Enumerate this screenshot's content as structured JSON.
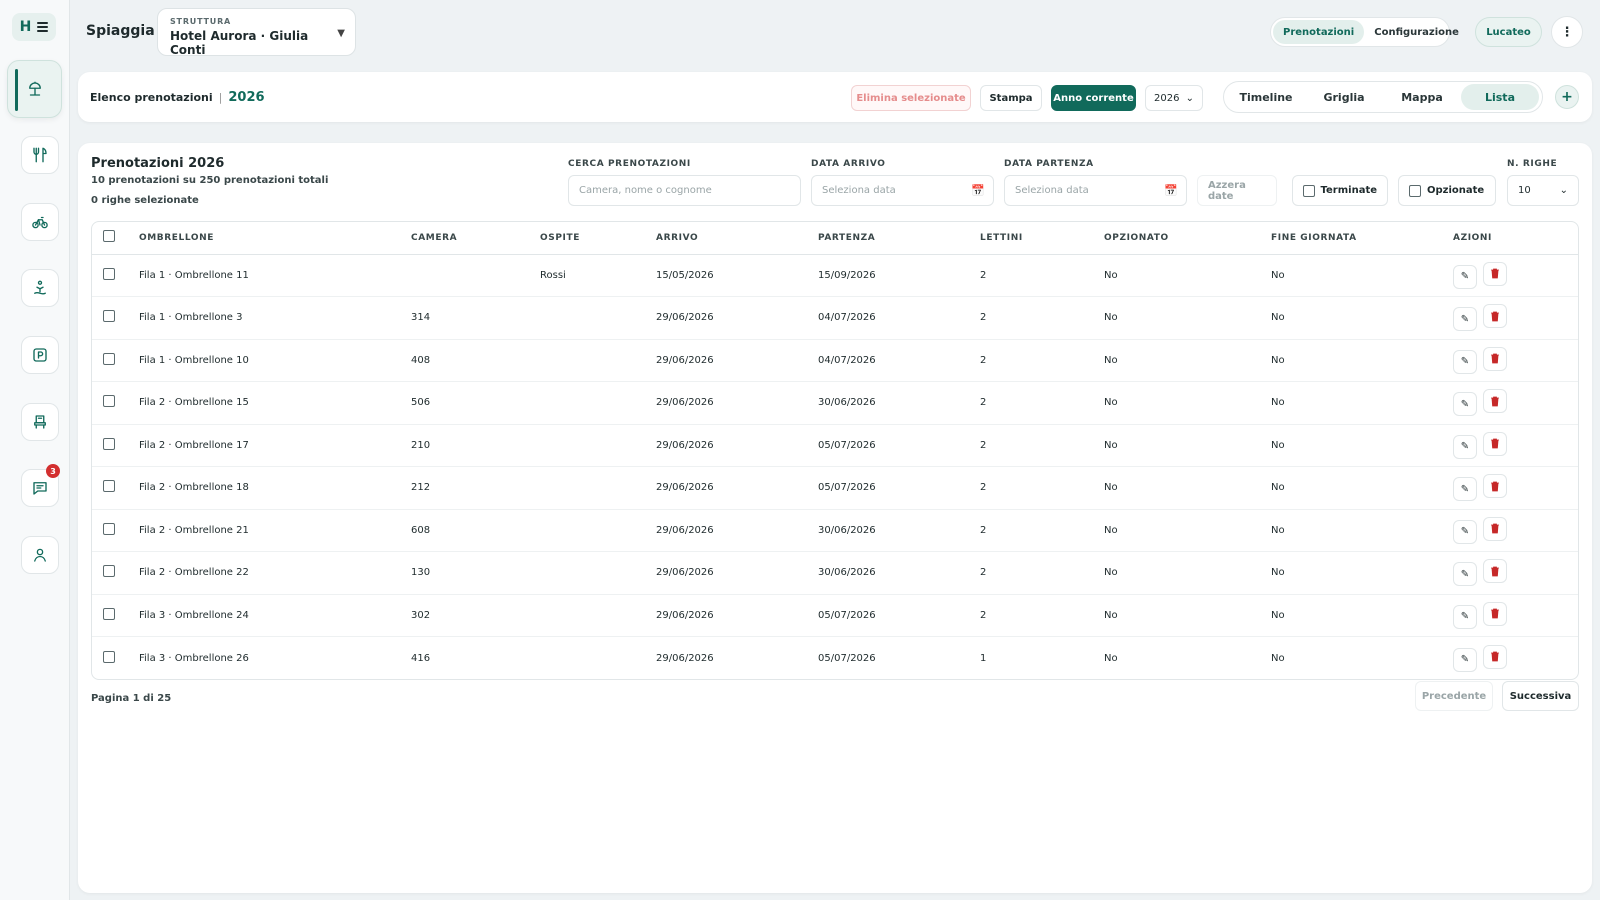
{
  "sidebar": {
    "logo_letter": "H",
    "items": [
      {
        "name": "beach-umbrella-icon"
      },
      {
        "name": "restaurant-icon"
      },
      {
        "name": "bike-icon"
      },
      {
        "name": "spa-icon"
      },
      {
        "name": "parking-icon"
      },
      {
        "name": "seat-icon"
      },
      {
        "name": "chat-icon",
        "badge": "3"
      },
      {
        "name": "user-icon"
      }
    ]
  },
  "header": {
    "title": "Spiaggia",
    "structure_label": "STRUTTURA",
    "structure_value": "Hotel Aurora · Giulia Conti",
    "tabs": [
      "Prenotazioni",
      "Configurazione"
    ],
    "active_tab": "Prenotazioni",
    "user_label": "Lucateo",
    "more_label": "⋮"
  },
  "toolbar": {
    "breadcrumb": "Elenco prenotazioni",
    "separator": "|",
    "year": "2026",
    "delete_selected": "Elimina selezionate",
    "print": "Stampa",
    "current_year": "Anno corrente",
    "year_select": "2026",
    "views": [
      "Timeline",
      "Griglia",
      "Mappa",
      "Lista"
    ],
    "active_view": "Lista",
    "add": "+"
  },
  "main": {
    "title": "Prenotazioni 2026",
    "subtitle": "10 prenotazioni su 250 prenotazioni totali",
    "selected": "0 righe selezionate",
    "filters": {
      "search_label": "CERCA PRENOTAZIONI",
      "search_placeholder": "Camera, nome o cognome",
      "arrival_label": "DATA ARRIVO",
      "arrival_placeholder": "Seleziona data",
      "departure_label": "DATA PARTENZA",
      "departure_placeholder": "Seleziona data",
      "reset_dates": "Azzera date",
      "finished": "Terminate",
      "optioned": "Opzionate",
      "rows_label": "N. RIGHE",
      "rows_value": "10"
    },
    "columns": [
      "OMBRELLONE",
      "CAMERA",
      "OSPITE",
      "ARRIVO",
      "PARTENZA",
      "LETTINI",
      "OPZIONATO",
      "FINE GIORNATA",
      "AZIONI"
    ],
    "rows": [
      {
        "umbrella": "Fila 1 · Ombrellone 11",
        "room": "",
        "guest": "Rossi",
        "arrival": "15/05/2026",
        "departure": "15/09/2026",
        "loungers": "2",
        "optioned": "No",
        "end_of_day": "No"
      },
      {
        "umbrella": "Fila 1 · Ombrellone 3",
        "room": "314",
        "guest": "",
        "arrival": "29/06/2026",
        "departure": "04/07/2026",
        "loungers": "2",
        "optioned": "No",
        "end_of_day": "No"
      },
      {
        "umbrella": "Fila 1 · Ombrellone 10",
        "room": "408",
        "guest": "",
        "arrival": "29/06/2026",
        "departure": "04/07/2026",
        "loungers": "2",
        "optioned": "No",
        "end_of_day": "No"
      },
      {
        "umbrella": "Fila 2 · Ombrellone 15",
        "room": "506",
        "guest": "",
        "arrival": "29/06/2026",
        "departure": "30/06/2026",
        "loungers": "2",
        "optioned": "No",
        "end_of_day": "No"
      },
      {
        "umbrella": "Fila 2 · Ombrellone 17",
        "room": "210",
        "guest": "",
        "arrival": "29/06/2026",
        "departure": "05/07/2026",
        "loungers": "2",
        "optioned": "No",
        "end_of_day": "No"
      },
      {
        "umbrella": "Fila 2 · Ombrellone 18",
        "room": "212",
        "guest": "",
        "arrival": "29/06/2026",
        "departure": "05/07/2026",
        "loungers": "2",
        "optioned": "No",
        "end_of_day": "No"
      },
      {
        "umbrella": "Fila 2 · Ombrellone 21",
        "room": "608",
        "guest": "",
        "arrival": "29/06/2026",
        "departure": "30/06/2026",
        "loungers": "2",
        "optioned": "No",
        "end_of_day": "No"
      },
      {
        "umbrella": "Fila 2 · Ombrellone 22",
        "room": "130",
        "guest": "",
        "arrival": "29/06/2026",
        "departure": "30/06/2026",
        "loungers": "2",
        "optioned": "No",
        "end_of_day": "No"
      },
      {
        "umbrella": "Fila 3 · Ombrellone 24",
        "room": "302",
        "guest": "",
        "arrival": "29/06/2026",
        "departure": "05/07/2026",
        "loungers": "2",
        "optioned": "No",
        "end_of_day": "No"
      },
      {
        "umbrella": "Fila 3 · Ombrellone 26",
        "room": "416",
        "guest": "",
        "arrival": "29/06/2026",
        "departure": "05/07/2026",
        "loungers": "1",
        "optioned": "No",
        "end_of_day": "No"
      }
    ],
    "pagination": {
      "info": "Pagina 1 di 25",
      "previous": "Precedente",
      "next": "Successiva"
    }
  },
  "colors": {
    "accent": "#116a5b",
    "danger": "#c62828",
    "background": "#eef2f4"
  }
}
